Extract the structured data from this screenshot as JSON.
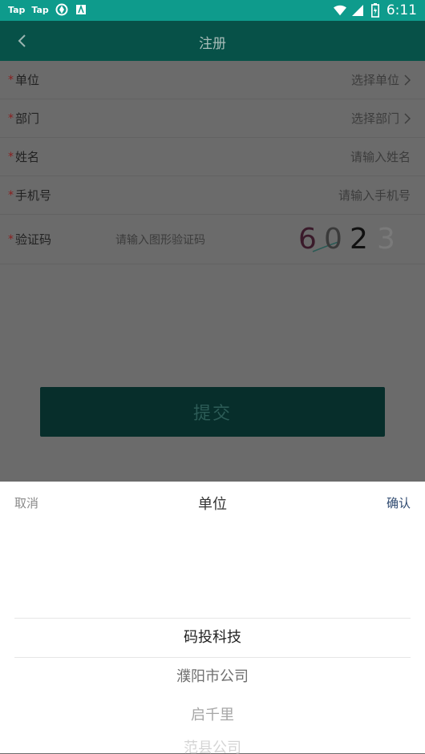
{
  "status_bar": {
    "left_items": [
      "Tap",
      "Tap"
    ],
    "time": "6:11",
    "icons": [
      "app-icon-ring",
      "app-icon-a",
      "wifi-icon",
      "signal-icon",
      "battery-icon"
    ]
  },
  "app_bar": {
    "title": "注册",
    "back_icon": "chevron-left-icon"
  },
  "form": {
    "required_mark": "*",
    "unit": {
      "label": "单位",
      "placeholder": "选择单位"
    },
    "department": {
      "label": "部门",
      "placeholder": "选择部门"
    },
    "name": {
      "label": "姓名",
      "placeholder": "请输入姓名"
    },
    "phone": {
      "label": "手机号",
      "placeholder": "请输入手机号"
    },
    "captcha": {
      "label": "验证码",
      "placeholder": "请输入图形验证码",
      "code": "6023"
    }
  },
  "submit_label": "提交",
  "picker_sheet": {
    "cancel_label": "取消",
    "title": "单位",
    "confirm_label": "确认",
    "options": [
      "码投科技",
      "濮阳市公司",
      "启千里",
      "范县公司"
    ],
    "selected": "码投科技"
  },
  "colors": {
    "status_bar": "#0e9b8c",
    "app_bar": "#075148",
    "overlay_bg": "#6b6b6b",
    "submit_bg": "#072e2b",
    "required": "#8a1e1e",
    "confirm": "#2f4a70"
  }
}
